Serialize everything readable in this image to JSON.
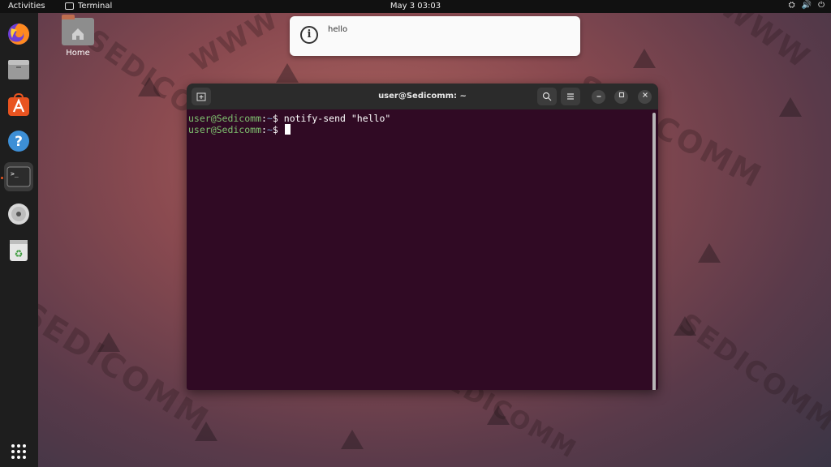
{
  "topbar": {
    "activities": "Activities",
    "app_name": "Terminal",
    "clock": "May 3  03:03",
    "tray": {
      "network": "⛭",
      "volume": "🔊",
      "power": "⏻"
    }
  },
  "desktop": {
    "home_label": "Home",
    "watermark": [
      "SEDICOMM",
      "WWW"
    ]
  },
  "notification": {
    "message": "hello"
  },
  "terminal": {
    "title": "user@Sedicomm: ~",
    "lines": [
      {
        "user": "user@Sedicomm",
        "path": "~",
        "prompt": "$",
        "command": "notify-send \"hello\""
      },
      {
        "user": "user@Sedicomm",
        "path": "~",
        "prompt": "$",
        "command": ""
      }
    ]
  },
  "dock": {
    "items": [
      "firefox-icon",
      "files-icon",
      "software-icon",
      "help-icon",
      "terminal-icon",
      "disc-icon",
      "trash-icon"
    ],
    "apps_grid": "apps-grid-icon"
  },
  "colors": {
    "terminal_bg": "#300a24",
    "accent": "#e95420",
    "user_green": "#7ec06f",
    "path_blue": "#729fcf"
  }
}
